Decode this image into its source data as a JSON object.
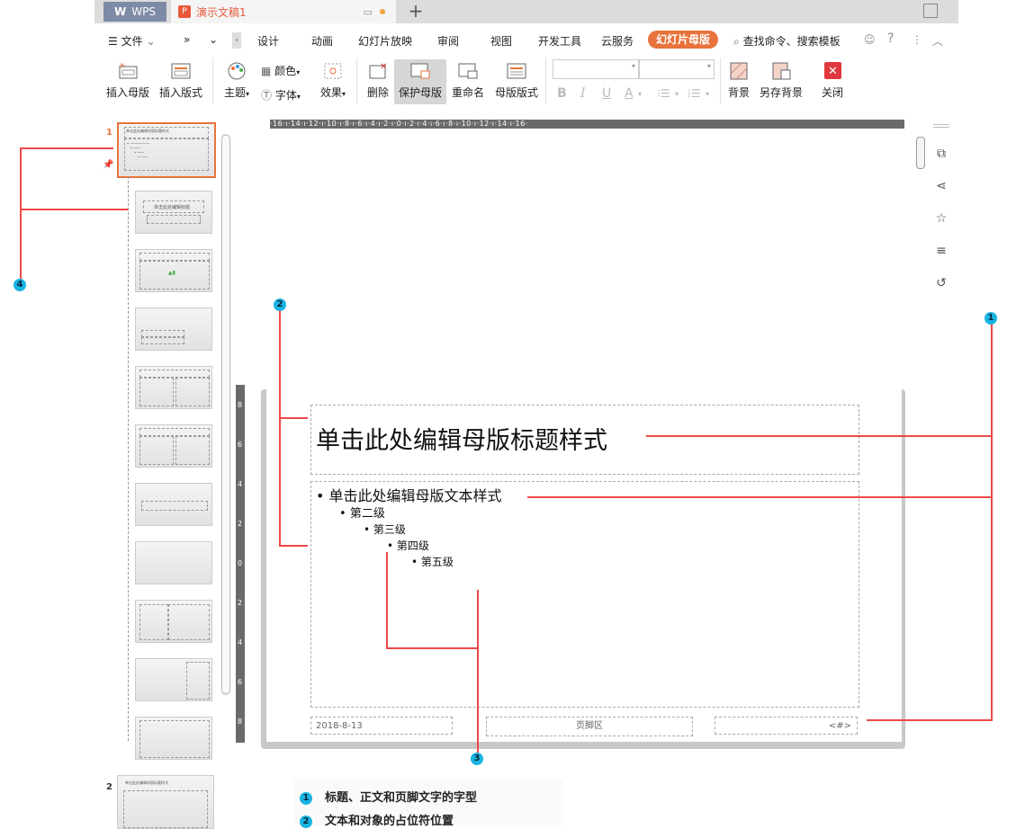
{
  "titlebar": {
    "app_tab": "WPS",
    "doc_tab": "演示文稿1",
    "doc_icon": "P",
    "new_tab": "+"
  },
  "menu": {
    "file": "文件",
    "items": [
      "设计",
      "动画",
      "幻灯片放映",
      "审阅",
      "视图",
      "开发工具",
      "云服务"
    ],
    "active": "幻灯片母版",
    "search": "查找命令、搜索模板"
  },
  "ribbon": {
    "insert_master": "插入母版",
    "insert_layout": "插入版式",
    "theme": "主题",
    "color": "颜色",
    "font": "字体",
    "effect": "效果",
    "delete": "删除",
    "protect_master": "保护母版",
    "rename": "重命名",
    "master_layout": "母版版式",
    "background": "背景",
    "save_background": "另存背景",
    "close": "关闭",
    "format_buttons": [
      "B",
      "I",
      "U",
      "A"
    ]
  },
  "thumbnails": {
    "first_number": "1",
    "second_number": "2",
    "master_title": "单击此处编辑母版标题样式",
    "layout_title": "单击此处编辑标题"
  },
  "ruler": {
    "horizontal": "·16·ı·14·ı·12·ı·10·ı·8·ı·6·ı·4·ı·2·ı·0·ı·2·ı·4·ı·6·ı·8·ı·10·ı·12·ı·14·ı·16·",
    "vertical": [
      "8",
      "6",
      "4",
      "2",
      "0",
      "2",
      "4",
      "6",
      "8"
    ]
  },
  "slide": {
    "title": "单击此处编辑母版标题样式",
    "level1": "单击此处编辑母版文本样式",
    "level2": "第二级",
    "level3": "第三级",
    "level4": "第四级",
    "level5": "第五级",
    "footer_date": "2018-8-13",
    "footer_center": "页脚区",
    "footer_number": "<#>"
  },
  "callouts": [
    "1",
    "2",
    "3",
    "4"
  ],
  "legend": [
    {
      "num": "1",
      "text": "标题、正文和页脚文字的字型"
    },
    {
      "num": "2",
      "text": "文本和对象的占位符位置"
    }
  ]
}
